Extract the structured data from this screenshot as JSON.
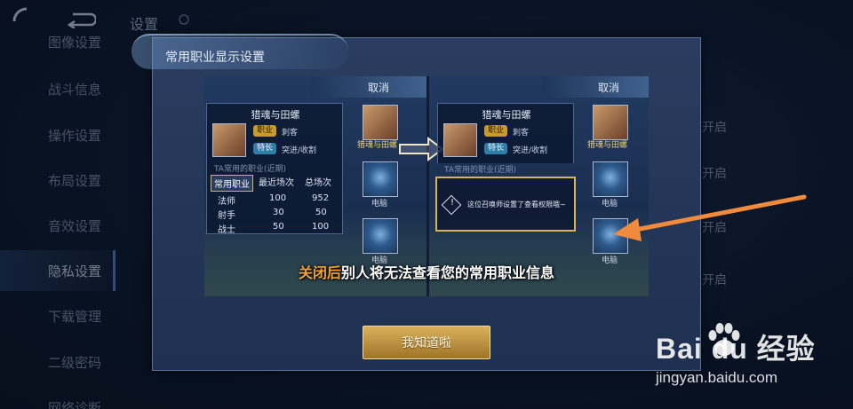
{
  "header": {
    "page_title": "设置"
  },
  "sidebar": {
    "items": [
      {
        "label": "图像设置"
      },
      {
        "label": "战斗信息"
      },
      {
        "label": "操作设置"
      },
      {
        "label": "布局设置"
      },
      {
        "label": "音效设置"
      },
      {
        "label": "隐私设置",
        "active": true
      },
      {
        "label": "下载管理"
      },
      {
        "label": "二级密码"
      },
      {
        "label": "网络诊断"
      }
    ]
  },
  "settings_right": {
    "values": [
      "开启",
      "开启",
      "开启",
      "开启"
    ]
  },
  "dialog": {
    "title": "常用职业显示设置",
    "confirm_label": "我知道啦",
    "preview": {
      "cancel_left": "取消",
      "cancel_right": "取消",
      "hero_name": "猎魂与田螺",
      "role_tag": "职业",
      "role_value": "刺客",
      "spec_tag": "特长",
      "spec_value": "突进/收割",
      "recent_label": "TA常用的职业(近期)",
      "tabs": [
        "常用职业",
        "最近场次",
        "总场次"
      ],
      "rows": [
        {
          "role": "法师",
          "recent": "100",
          "total": "952"
        },
        {
          "role": "射手",
          "recent": "30",
          "total": "50"
        },
        {
          "role": "战士",
          "recent": "50",
          "total": "100"
        }
      ],
      "slot_name": "猎魂与田螺",
      "slot_label": "电脑",
      "tip_text": "这位召唤师设置了查看权限哦~",
      "caption_highlight": "关闭后",
      "caption_rest": "别人将无法查看您的常用职业信息"
    }
  },
  "watermark": {
    "logo": "Bai du 经验",
    "url": "jingyan.baidu.com"
  },
  "colors": {
    "accent_gold": "#d9b35a",
    "arrow_orange": "#f08a3c",
    "highlight_orange": "#f3a23a"
  },
  "icons": [
    "back-icon",
    "return-icon",
    "settings-title-icon",
    "warning-icon",
    "paw-logo-icon",
    "pointer-arrow-icon"
  ]
}
